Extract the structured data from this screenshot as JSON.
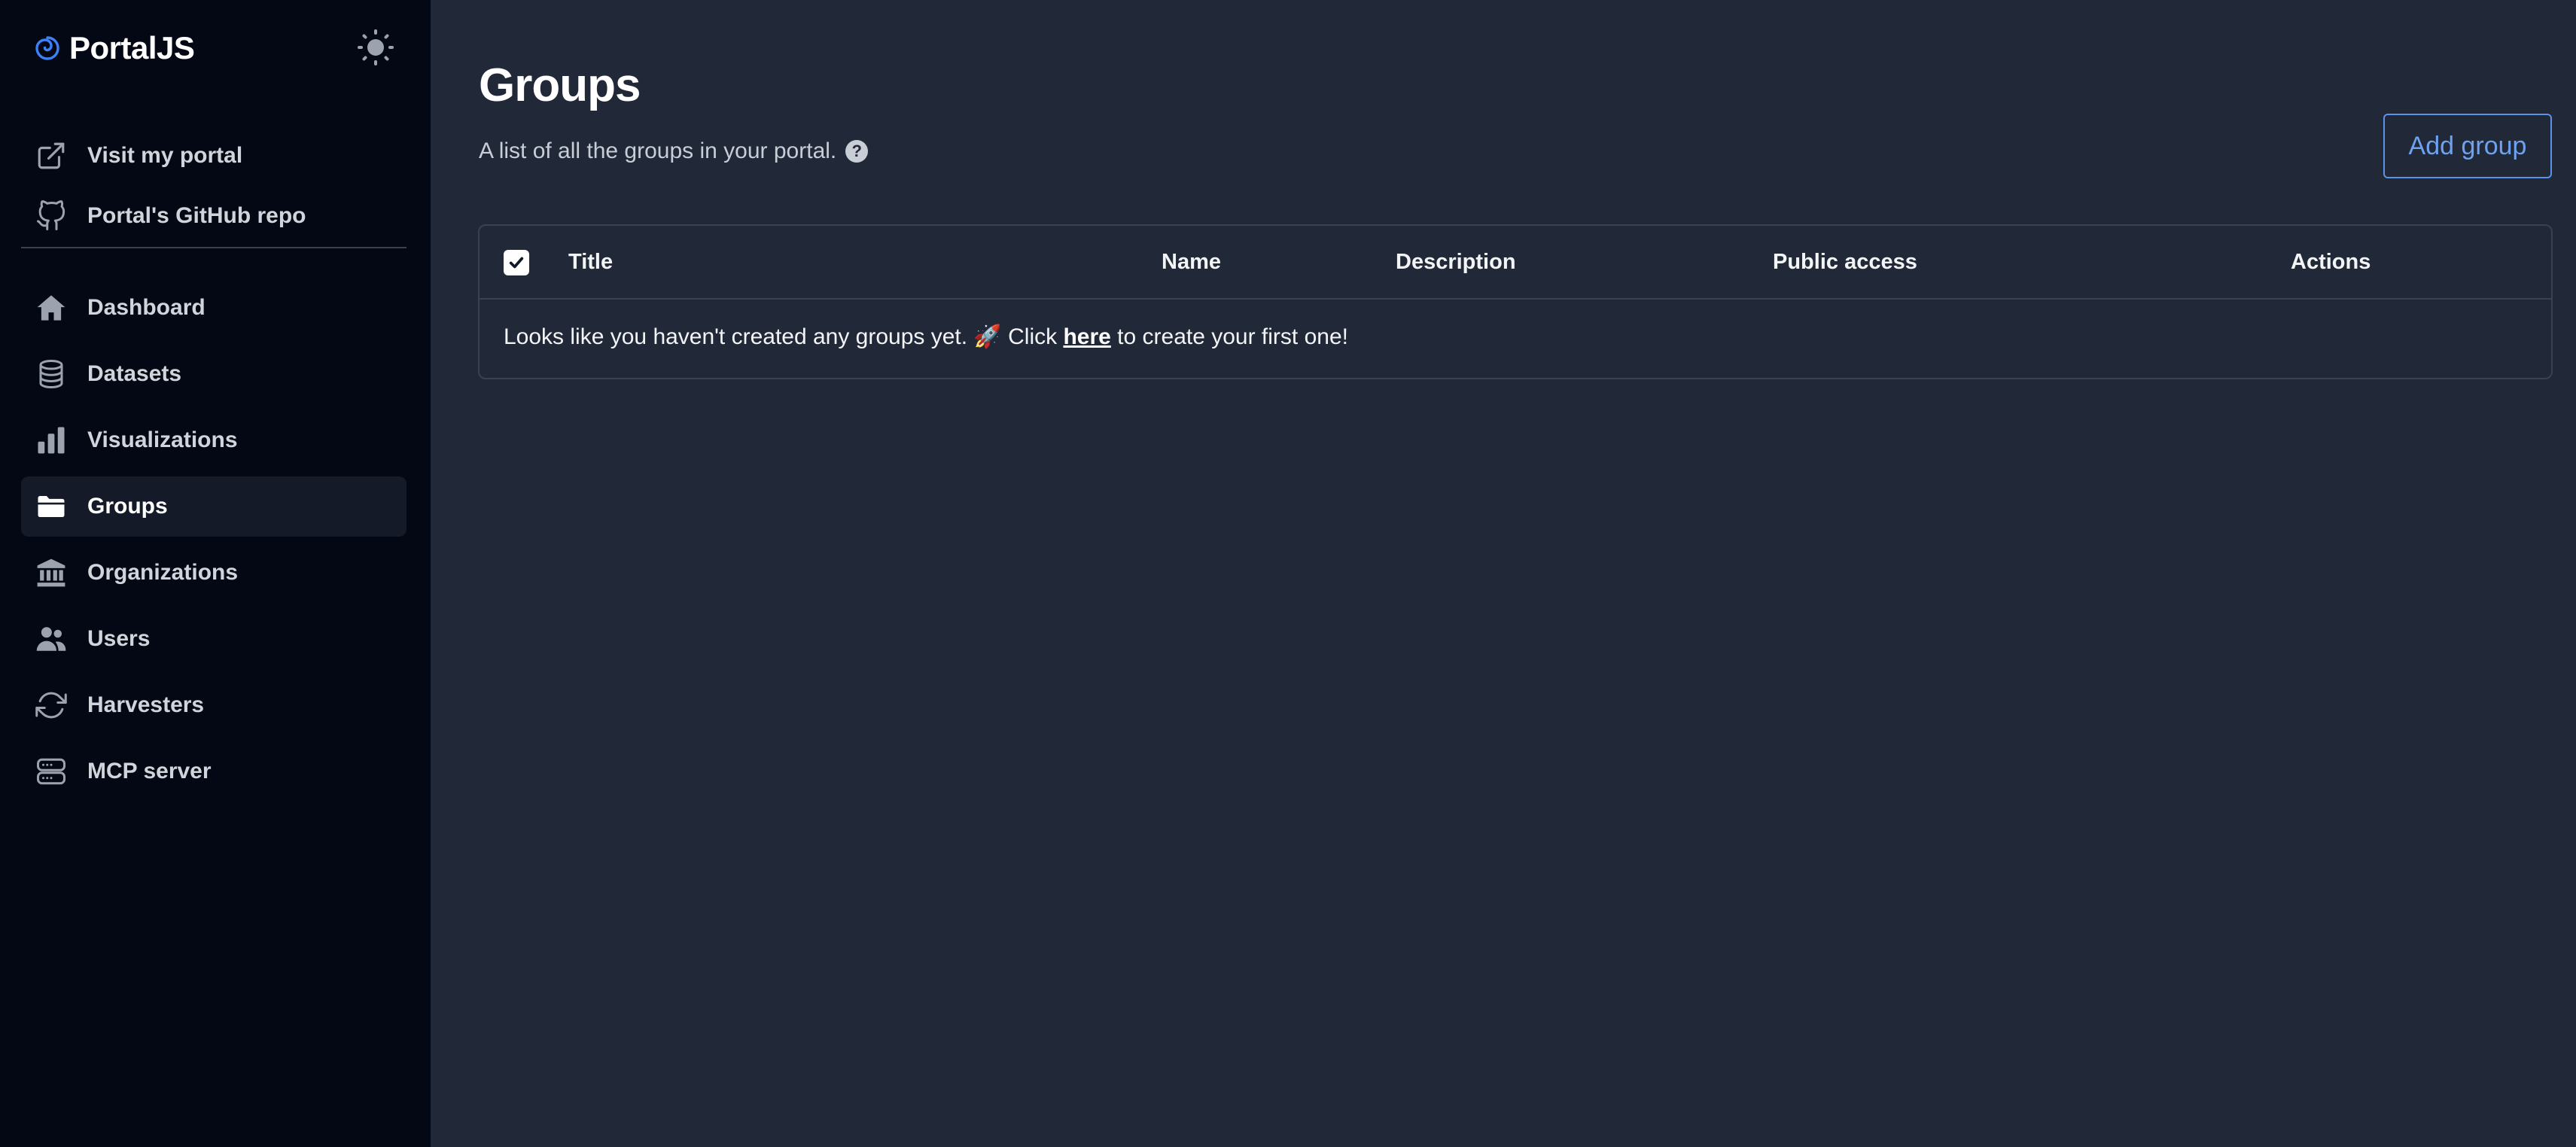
{
  "brand": {
    "name": "PortalJS"
  },
  "sidebar": {
    "external_links": [
      {
        "label": "Visit my portal",
        "icon": "external-link-icon"
      },
      {
        "label": "Portal's GitHub repo",
        "icon": "github-icon"
      }
    ],
    "items": [
      {
        "label": "Dashboard",
        "icon": "home-icon",
        "active": false
      },
      {
        "label": "Datasets",
        "icon": "database-icon",
        "active": false
      },
      {
        "label": "Visualizations",
        "icon": "bar-chart-icon",
        "active": false
      },
      {
        "label": "Groups",
        "icon": "folder-icon",
        "active": true
      },
      {
        "label": "Organizations",
        "icon": "building-icon",
        "active": false
      },
      {
        "label": "Users",
        "icon": "users-icon",
        "active": false
      },
      {
        "label": "Harvesters",
        "icon": "refresh-icon",
        "active": false
      },
      {
        "label": "MCP server",
        "icon": "server-icon",
        "active": false
      }
    ]
  },
  "page": {
    "title": "Groups",
    "subtitle": "A list of all the groups in your portal.",
    "help_glyph": "?",
    "add_button_label": "Add group"
  },
  "table": {
    "columns": [
      "Title",
      "Name",
      "Description",
      "Public access",
      "Actions"
    ],
    "empty_prefix": "Looks like you haven't created any groups yet. 🚀 Click ",
    "empty_link": "here",
    "empty_suffix": " to create your first one!"
  },
  "colors": {
    "sidebar_bg": "#030814",
    "main_bg": "#212939",
    "accent": "#6ea2f0",
    "logo": "#3b82f6"
  }
}
